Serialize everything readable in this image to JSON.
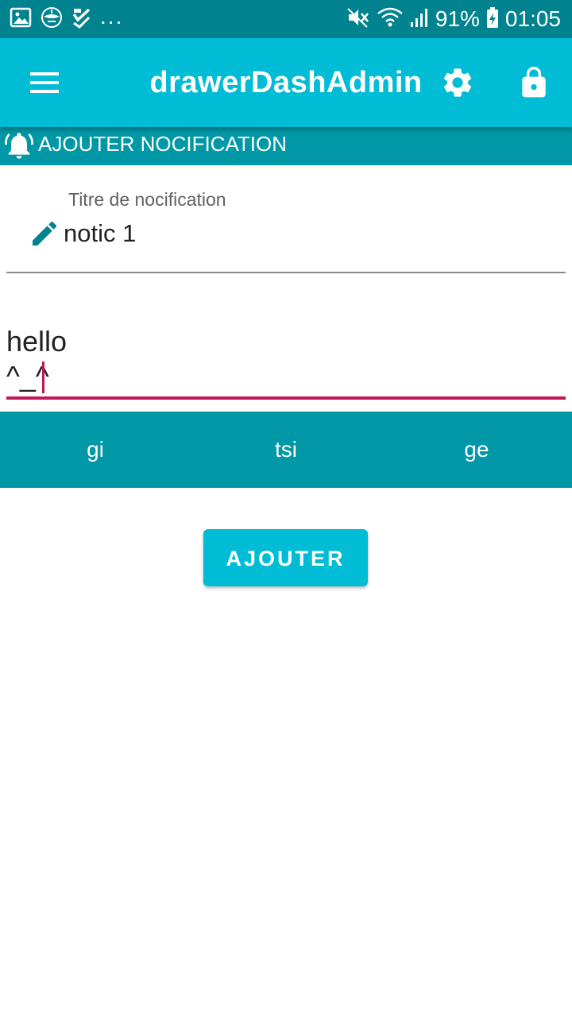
{
  "status_bar": {
    "dots": "...",
    "battery_percent": "91%",
    "time": "01:05"
  },
  "app_bar": {
    "title": "drawerDashAdmin"
  },
  "section": {
    "title": "AJOUTER NOCIFICATION"
  },
  "title_field": {
    "label": "Titre de nocification",
    "value": "notic 1"
  },
  "message_field": {
    "line1": "hello",
    "line2": "^_^"
  },
  "tabs": [
    {
      "label": "gi"
    },
    {
      "label": "tsi"
    },
    {
      "label": "ge"
    }
  ],
  "add_button": {
    "label": "AJOUTER"
  },
  "colors": {
    "status_bar": "#00838f",
    "app_bar": "#00bcd4",
    "section_header": "#0097a7",
    "tab_bar": "#0097a7",
    "accent": "#c2185b",
    "icon_teal": "#00838f"
  },
  "icons": {
    "status_left": [
      "gallery-icon",
      "app-logo-icon",
      "checklist-icon"
    ],
    "status_right": [
      "mute-icon",
      "wifi-icon",
      "signal-icon",
      "battery-charging-icon"
    ],
    "app_bar": [
      "menu-icon",
      "gear-icon",
      "lock-icon"
    ],
    "section": "bell-icon",
    "title_field": "pencil-icon"
  }
}
